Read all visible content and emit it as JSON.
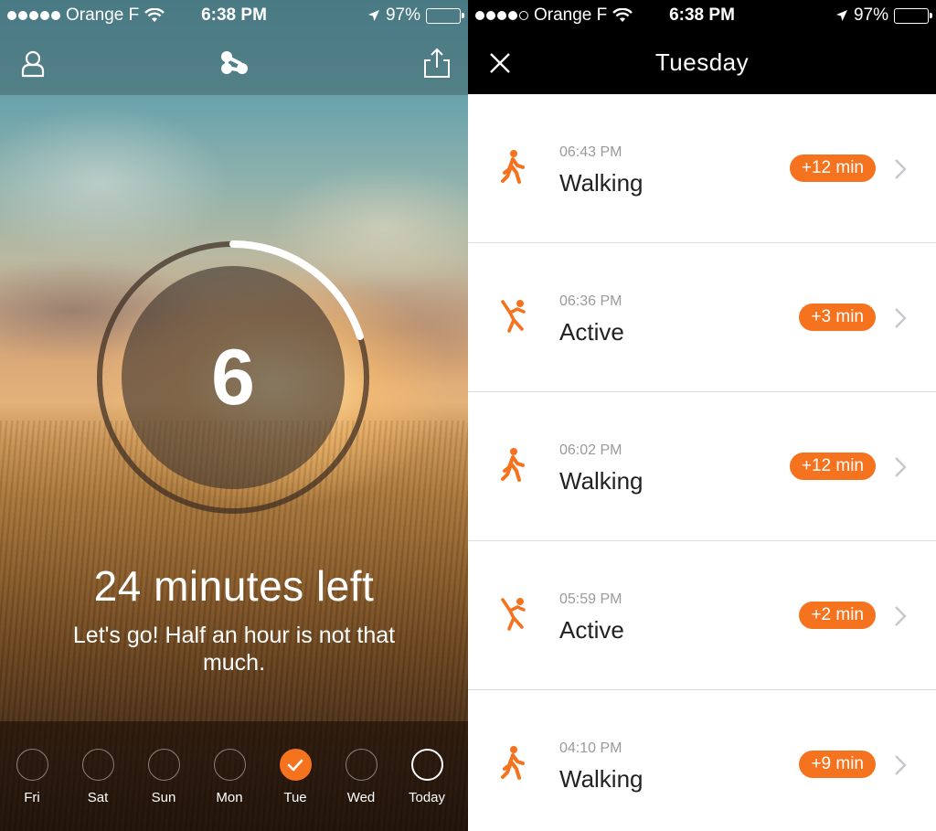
{
  "colors": {
    "accent": "#f5721f",
    "header_bg": "#000000",
    "row_divider": "#dcdcdc"
  },
  "status_bar": {
    "carrier": "Orange F",
    "time": "6:38 PM",
    "battery": "97%"
  },
  "left": {
    "nav": {
      "profile_icon": "person-outline-icon",
      "center_icon": "share-nodes-icon",
      "export_icon": "share-upload-icon"
    },
    "progress": {
      "value": 6,
      "fraction_complete": 0.2
    },
    "minutes_left": "24 minutes left",
    "motivation": "Let's go! Half an hour is not that much.",
    "days": [
      {
        "label": "Fri",
        "state": "empty"
      },
      {
        "label": "Sat",
        "state": "empty"
      },
      {
        "label": "Sun",
        "state": "empty"
      },
      {
        "label": "Mon",
        "state": "empty"
      },
      {
        "label": "Tue",
        "state": "done"
      },
      {
        "label": "Wed",
        "state": "empty"
      },
      {
        "label": "Today",
        "state": "today"
      }
    ]
  },
  "right": {
    "title": "Tuesday",
    "close_icon": "close-icon",
    "activities": [
      {
        "time": "06:43 PM",
        "name": "Walking",
        "badge": "+12 min",
        "icon": "walking-icon"
      },
      {
        "time": "06:36 PM",
        "name": "Active",
        "badge": "+3 min",
        "icon": "active-figure-icon"
      },
      {
        "time": "06:02 PM",
        "name": "Walking",
        "badge": "+12 min",
        "icon": "walking-icon"
      },
      {
        "time": "05:59 PM",
        "name": "Active",
        "badge": "+2 min",
        "icon": "active-figure-icon"
      },
      {
        "time": "04:10 PM",
        "name": "Walking",
        "badge": "+9 min",
        "icon": "walking-icon"
      }
    ]
  }
}
